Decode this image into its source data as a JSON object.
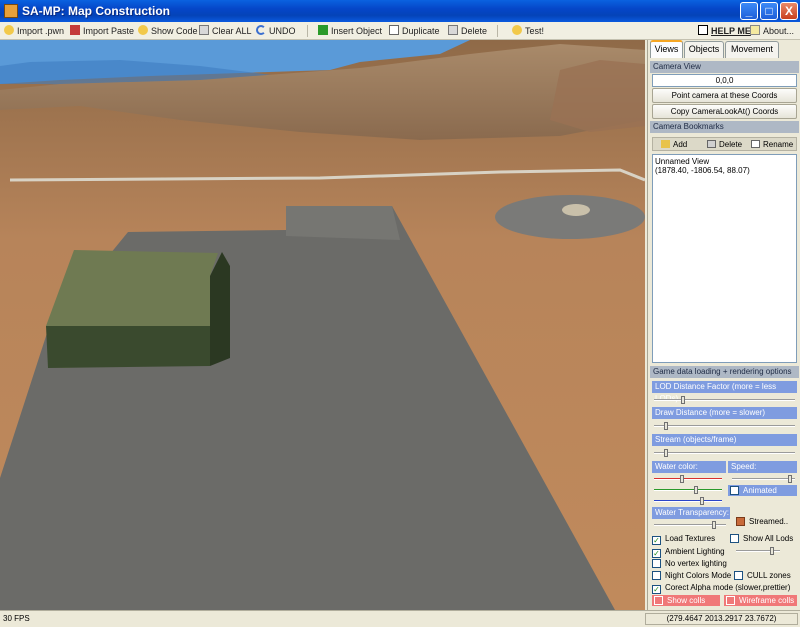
{
  "window": {
    "title": "SA-MP: Map Construction",
    "buttons": {
      "minimize": "_",
      "maximize": "□",
      "close": "X"
    }
  },
  "toolbar": {
    "import_pwn": "Import .pwn",
    "import_paste": "Import Paste",
    "show_code": "Show Code",
    "clear_all": "Clear ALL",
    "undo": "UNDO",
    "insert_object": "Insert Object",
    "duplicate": "Duplicate",
    "delete": "Delete",
    "test": "Test!",
    "help_me": "HELP ME",
    "about": "About..."
  },
  "tabs": [
    {
      "label": "Views",
      "active": true
    },
    {
      "label": "Objects",
      "active": false
    },
    {
      "label": "Movement",
      "active": false
    }
  ],
  "camera_view": {
    "header": "Camera View",
    "coords": "0,0,0",
    "point_button": "Point camera at these Coords",
    "copy_button": "Copy CameraLookAt() Coords"
  },
  "bookmarks": {
    "header": "Camera Bookmarks",
    "add": "Add",
    "delete": "Delete",
    "rename": "Rename",
    "items": [
      {
        "name": "Unnamed View",
        "coords": "(1878.40, -1806.54, 88.07)"
      }
    ]
  },
  "rendering": {
    "header": "Game data loading + rendering options",
    "lod_label": "LOD Distance Factor (more = less LODs)",
    "lod_value": 0.2,
    "draw_label": "Draw Distance (more = slower)",
    "draw_value": 0.07,
    "stream_label": "Stream (objects/frame)",
    "stream_value": 0.07,
    "water_color_label": "Water color:",
    "speed_label": "Speed:",
    "animated_label": "Animated",
    "animated": false,
    "water_transparency_label": "Water Transparency:",
    "streamed_label": "Streamed..",
    "water_red": 0.4,
    "water_green": 0.62,
    "water_blue": 0.72,
    "speed_value": 0.95,
    "transparency_value": 0.85,
    "ambient_value": 0.85
  },
  "checkboxes": {
    "load_textures": {
      "label": "Load Textures",
      "checked": true
    },
    "show_all_lods": {
      "label": "Show All Lods",
      "checked": false
    },
    "ambient_lighting": {
      "label": "Ambient Lighting",
      "checked": true
    },
    "no_vertex_lighting": {
      "label": "No vertex lighting",
      "checked": false
    },
    "night_colors_mode": {
      "label": "Night Colors Mode",
      "checked": false
    },
    "cull_zones": {
      "label": "CULL zones",
      "checked": false
    },
    "correct_alpha": {
      "label": "Corect Alpha mode (slower,prettier)",
      "checked": true
    },
    "show_colls": {
      "label": "Show colls",
      "checked": false
    },
    "wireframe_colls": {
      "label": "Wireframe colls",
      "checked": false
    }
  },
  "status": {
    "fps": "30 FPS",
    "coords": "(279.4647 2013.2917 23.7672)"
  },
  "colors": {
    "titlebar": "#0546c8",
    "section_label": "#7f9ce0",
    "coll_buttons": "#f07878",
    "ground": "#b8855a",
    "concrete": "#6b6b68",
    "water": "#5a9ad8"
  }
}
